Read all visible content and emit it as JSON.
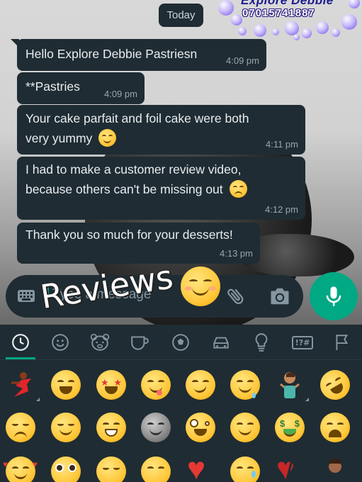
{
  "chat": {
    "date_label": "Today",
    "messages": [
      {
        "text": "Hello Explore Debbie Pastriesn",
        "time": "4:09 pm"
      },
      {
        "text": "**Pastries",
        "time": "4:09 pm"
      },
      {
        "line1": "Your cake parfait and foil cake were both",
        "line2": "very yummy",
        "emoji": "smiling-face-icon",
        "time": "4:11 pm"
      },
      {
        "line1": "I had to make a customer review video,",
        "line2": "because others can't be missing out",
        "emoji": "weary-face-icon",
        "time": "4:12 pm"
      },
      {
        "text": "Thank you so much for your desserts!",
        "time": "4:13 pm"
      }
    ]
  },
  "watermark": {
    "name": "Explore Debbie",
    "phone": "07015741887"
  },
  "composer": {
    "placeholder": "Type a message",
    "icons": [
      "keyboard-icon",
      "paperclip-icon",
      "camera-icon",
      "microphone-icon"
    ]
  },
  "overlay": {
    "title": "Reviews",
    "emoji": "smiling-face-with-smiling-eyes-icon"
  },
  "emoji_keyboard": {
    "categories": [
      "recent-icon",
      "smileys-icon",
      "animals-icon",
      "food-icon",
      "activity-icon",
      "travel-icon",
      "objects-icon",
      "symbols-icon",
      "flags-icon"
    ],
    "symbols_label": "!?#",
    "selected_category": "recent-icon",
    "colors": {
      "accent": "#00a884",
      "panel": "#1f2c33",
      "icon": "#8696a0"
    }
  }
}
